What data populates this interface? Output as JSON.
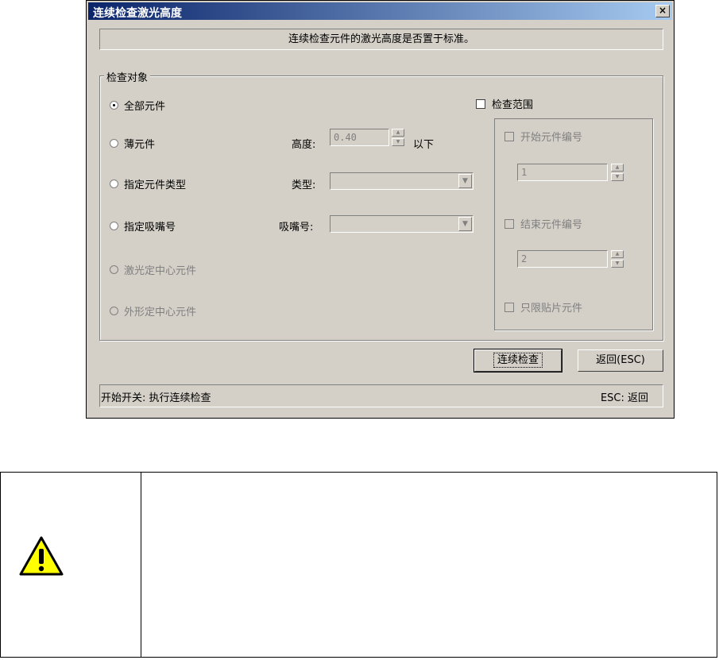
{
  "window": {
    "title": "连续检查激光高度",
    "close_label": "×"
  },
  "message": "连续检查元件的激光高度是否置于标准。",
  "group": {
    "title": "检查对象",
    "radios": [
      {
        "label": "全部元件",
        "checked": true,
        "enabled": true
      },
      {
        "label": "薄元件",
        "checked": false,
        "enabled": true
      },
      {
        "label": "指定元件类型",
        "checked": false,
        "enabled": true
      },
      {
        "label": "指定吸嘴号",
        "checked": false,
        "enabled": true
      },
      {
        "label": "激光定中心元件",
        "checked": false,
        "enabled": false
      },
      {
        "label": "外形定中心元件",
        "checked": false,
        "enabled": false
      }
    ],
    "height_label": "高度:",
    "height_value": "0.40",
    "height_suffix": "以下",
    "type_label": "类型:",
    "type_value": "",
    "nozzle_label": "吸嘴号:",
    "nozzle_value": ""
  },
  "range": {
    "checkbox_label": "检查范围",
    "start_label": "开始元件编号",
    "start_value": "1",
    "end_label": "结束元件编号",
    "end_value": "2",
    "chip_only_label": "只限贴片元件"
  },
  "buttons": {
    "continuous_check": "连续检查",
    "back": "返回(ESC)"
  },
  "status": {
    "left": "开始开关: 执行连续检查",
    "right": "ESC: 返回"
  },
  "icons": {
    "warning": "warning-icon"
  },
  "colors": {
    "dialog_bg": "#d4d0c8",
    "title_bar": "#0a246a",
    "warning_fill": "#ffff00"
  }
}
